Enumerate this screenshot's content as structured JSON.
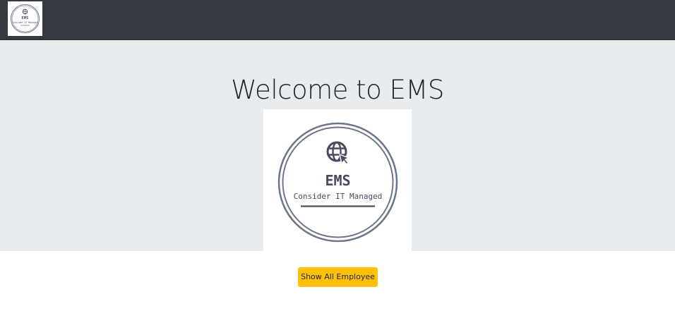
{
  "navbar": {
    "logo": {
      "title": "EMS",
      "tagline": "Consider IT Managed",
      "icon": "globe-cursor-icon"
    }
  },
  "jumbotron": {
    "heading": "Welcome to EMS",
    "logo": {
      "title": "EMS",
      "tagline": "Consider IT Managed",
      "icon": "globe-cursor-icon"
    }
  },
  "actions": {
    "show_all_label": "Show All Employee"
  },
  "colors": {
    "navbar_bg": "#343a40",
    "jumbotron_bg": "#e9ecef",
    "button_bg": "#ffc107",
    "logo_ring": "#6b7689",
    "logo_text": "#4a4a5e"
  }
}
